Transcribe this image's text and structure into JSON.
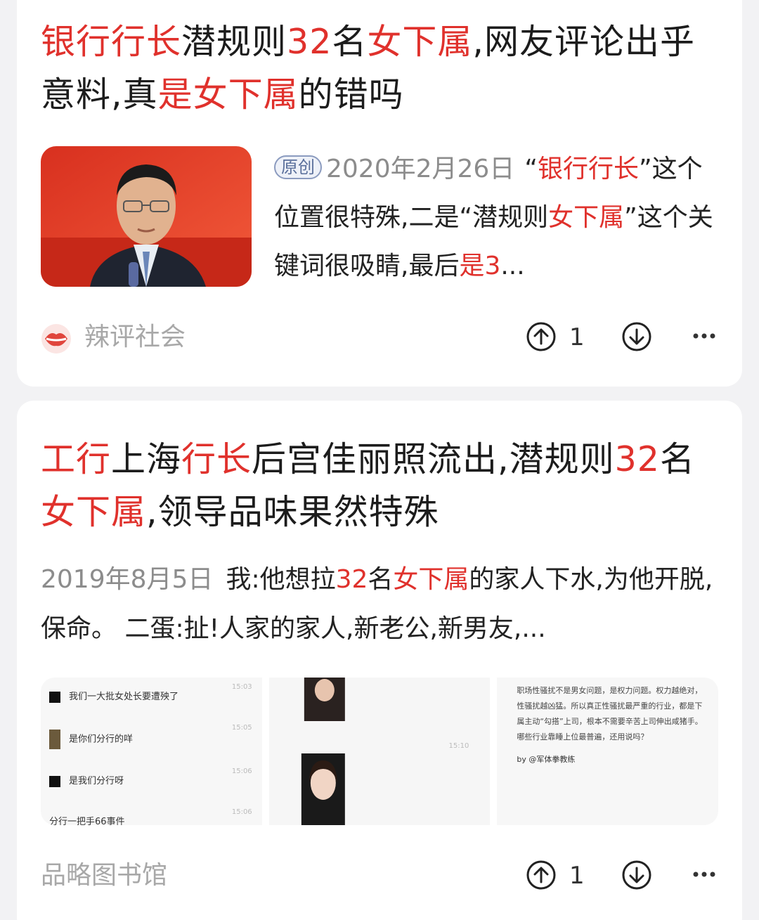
{
  "card1": {
    "title": [
      {
        "t": "银行行长",
        "hl": true
      },
      {
        "t": "潜规则",
        "hl": false
      },
      {
        "t": "32",
        "hl": true
      },
      {
        "t": "名",
        "hl": false
      },
      {
        "t": "女下属",
        "hl": true
      },
      {
        "t": ",网友评论出乎意料,真",
        "hl": false
      },
      {
        "t": "是女下属",
        "hl": true
      },
      {
        "t": "的错吗",
        "hl": false
      }
    ],
    "badge": "原创",
    "date": "2020年2月26日",
    "snippet": [
      {
        "t": "“",
        "hl": false
      },
      {
        "t": "银行行长",
        "hl": true
      },
      {
        "t": "”这个位置很特殊,二是“潜规则",
        "hl": false
      },
      {
        "t": "女下属",
        "hl": true
      },
      {
        "t": "”这个关键词很吸睛,最后",
        "hl": false
      },
      {
        "t": "是3",
        "hl": true
      },
      {
        "t": "...",
        "hl": false
      }
    ],
    "source": "辣评社会",
    "upvotes": "1"
  },
  "card2": {
    "title": [
      {
        "t": "工行",
        "hl": true
      },
      {
        "t": "上海",
        "hl": false
      },
      {
        "t": "行长",
        "hl": true
      },
      {
        "t": "后宫佳丽照流出,潜规则",
        "hl": false
      },
      {
        "t": "32",
        "hl": true
      },
      {
        "t": "名",
        "hl": false
      },
      {
        "t": "女下属",
        "hl": true
      },
      {
        "t": ",领导品味果然特殊",
        "hl": false
      }
    ],
    "date": "2019年8月5日",
    "snippet": [
      {
        "t": "我:他想拉",
        "hl": false
      },
      {
        "t": "32",
        "hl": true
      },
      {
        "t": "名",
        "hl": false
      },
      {
        "t": "女下属",
        "hl": true
      },
      {
        "t": "的家人下水,为他开脱,保命。 二蛋:扯!人家的家人,新老公,新男友,...",
        "hl": false
      }
    ],
    "gallery": {
      "chat": [
        {
          "text": "我们一大批女处长要遭殃了",
          "time": "15:03"
        },
        {
          "text": "是你们分行的咩",
          "time": "15:05"
        },
        {
          "text": "是我们分行呀",
          "time": "15:06"
        },
        {
          "text": "分行一把手66事件",
          "time": "15:06"
        }
      ],
      "middle_time": "15:10",
      "note": "职场性骚扰不是男女问题，是权力问题。权力越绝对，性骚扰越凶猛。所以真正性骚扰最严重的行业，都是下属主动“勾搭”上司，根本不需要辛苦上司伸出咸猪手。哪些行业靠睡上位最普遍，还用说吗？",
      "note_by": "by @军体拳教练"
    },
    "source": "品略图书馆",
    "upvotes": "1"
  },
  "colors": {
    "highlight": "#e0312c",
    "muted": "#a8a8a8",
    "background": "#f2f2f4"
  },
  "icons": {
    "upvote": "arrow-up-circle-icon",
    "downvote": "arrow-down-circle-icon",
    "more": "ellipsis-icon",
    "source_avatar": "lips-icon"
  }
}
